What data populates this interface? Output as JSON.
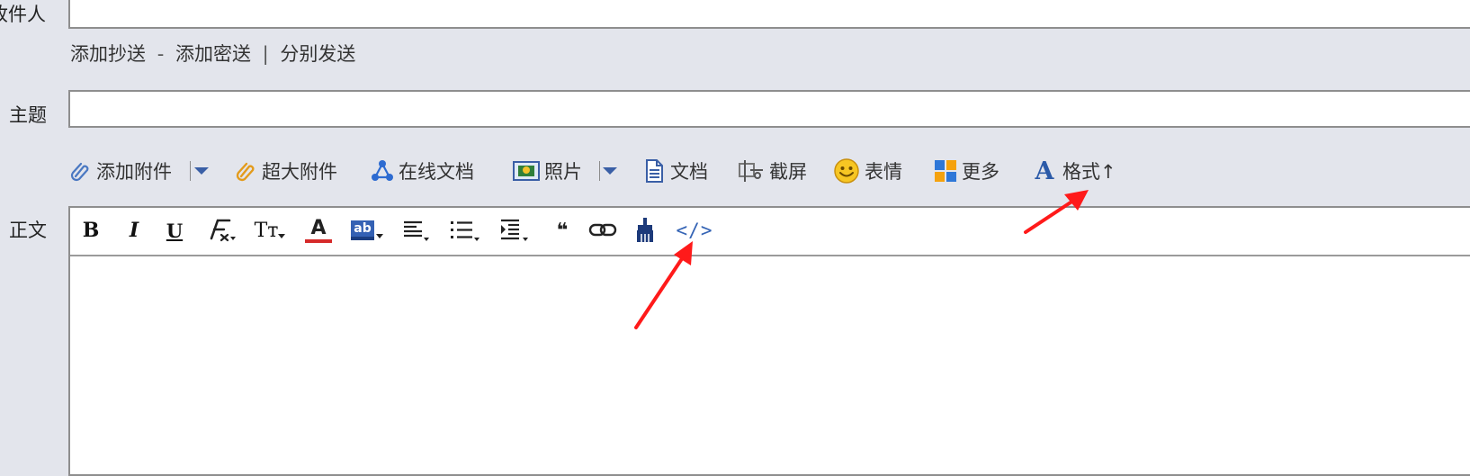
{
  "recipient": {
    "label": "收件人",
    "value": ""
  },
  "cc_links": {
    "add_cc": "添加抄送",
    "dash": "-",
    "add_bcc": "添加密送",
    "pipe": "|",
    "send_separately": "分别发送"
  },
  "subject": {
    "label": "主题",
    "value": ""
  },
  "attach_toolbar": {
    "add_attachment": "添加附件",
    "large_attachment": "超大附件",
    "online_doc": "在线文档",
    "photo": "照片",
    "document": "文档",
    "screenshot": "截屏",
    "emoji": "表情",
    "more": "更多",
    "format_icon_glyph": "A",
    "format": "格式↑"
  },
  "body": {
    "label": "正文",
    "content": ""
  },
  "format_toolbar": {
    "bold_glyph": "B",
    "italic_glyph": "I",
    "underline_glyph": "U",
    "font_size_glyph": "Tт",
    "text_color_glyph": "A",
    "bg_color_glyph": "ab",
    "quote_glyph": "❝",
    "source_code": "</>"
  },
  "colors": {
    "page_bg": "#e3e5ec",
    "input_border": "#8e8e8e",
    "link_blue": "#3564b5",
    "annotation_red": "#ff1a1a",
    "text_color_underline": "#d62a2a"
  },
  "icons": {
    "attachment": "paperclip-icon",
    "large_attachment": "paperclip-orange-icon",
    "online_doc": "triangle-nodes-icon",
    "photo": "picture-icon",
    "document": "document-icon",
    "screenshot": "scissors-icon",
    "emoji": "smiley-icon",
    "more": "grid-icon",
    "format": "letter-a-icon"
  }
}
